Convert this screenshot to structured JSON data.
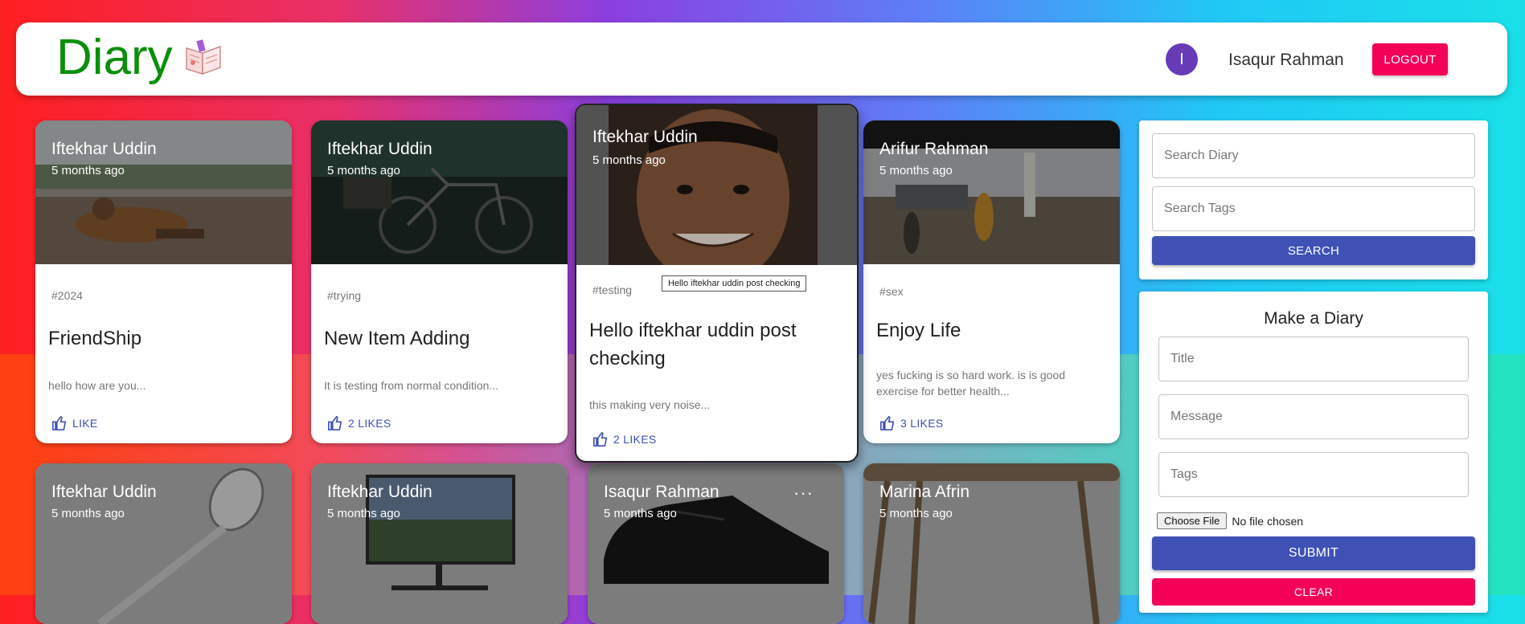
{
  "header": {
    "brand": "Diary",
    "avatar_initial": "I",
    "user_name": "Isaqur Rahman",
    "logout_label": "LOGOUT"
  },
  "posts": [
    {
      "author": "Iftekhar Uddin",
      "time": "5 months ago",
      "tags": "#2024",
      "title": "FriendShip",
      "message": "hello how are you...",
      "likes": "LIKE"
    },
    {
      "author": "Iftekhar Uddin",
      "time": "5 months ago",
      "tags": "#trying",
      "title": "New Item Adding",
      "message": "It is testing from normal condition...",
      "likes": "2 LIKES"
    },
    {
      "author": "Iftekhar Uddin",
      "time": "5 months ago",
      "tags": "#testing",
      "title": "Hello iftekhar uddin post checking",
      "message": "this making very noise...",
      "likes": "2 LIKES",
      "tooltip": "Hello iftekhar uddin post checking"
    },
    {
      "author": "Arifur Rahman",
      "time": "5 months ago",
      "tags": "#sex",
      "title": "Enjoy Life",
      "message": "yes fucking is so hard work. is is good exercise for better health...",
      "likes": "3 LIKES"
    },
    {
      "author": "Iftekhar Uddin",
      "time": "5 months ago"
    },
    {
      "author": "Iftekhar Uddin",
      "time": "5 months ago"
    },
    {
      "author": "Isaqur Rahman",
      "time": "5 months ago",
      "more": "···"
    },
    {
      "author": "Marina Afrin",
      "time": "5 months ago"
    }
  ],
  "search": {
    "diary_placeholder": "Search Diary",
    "tags_placeholder": "Search Tags",
    "button_label": "SEARCH"
  },
  "form": {
    "heading": "Make a Diary",
    "title_placeholder": "Title",
    "message_placeholder": "Message",
    "tags_placeholder": "Tags",
    "file_button": "Choose File",
    "file_status": "No file chosen",
    "submit_label": "SUBMIT",
    "clear_label": "CLEAR"
  },
  "colors": {
    "brand": "#0b8f0b",
    "primary": "#3f51b5",
    "secondary": "#f50057",
    "avatar": "#673ab7"
  }
}
